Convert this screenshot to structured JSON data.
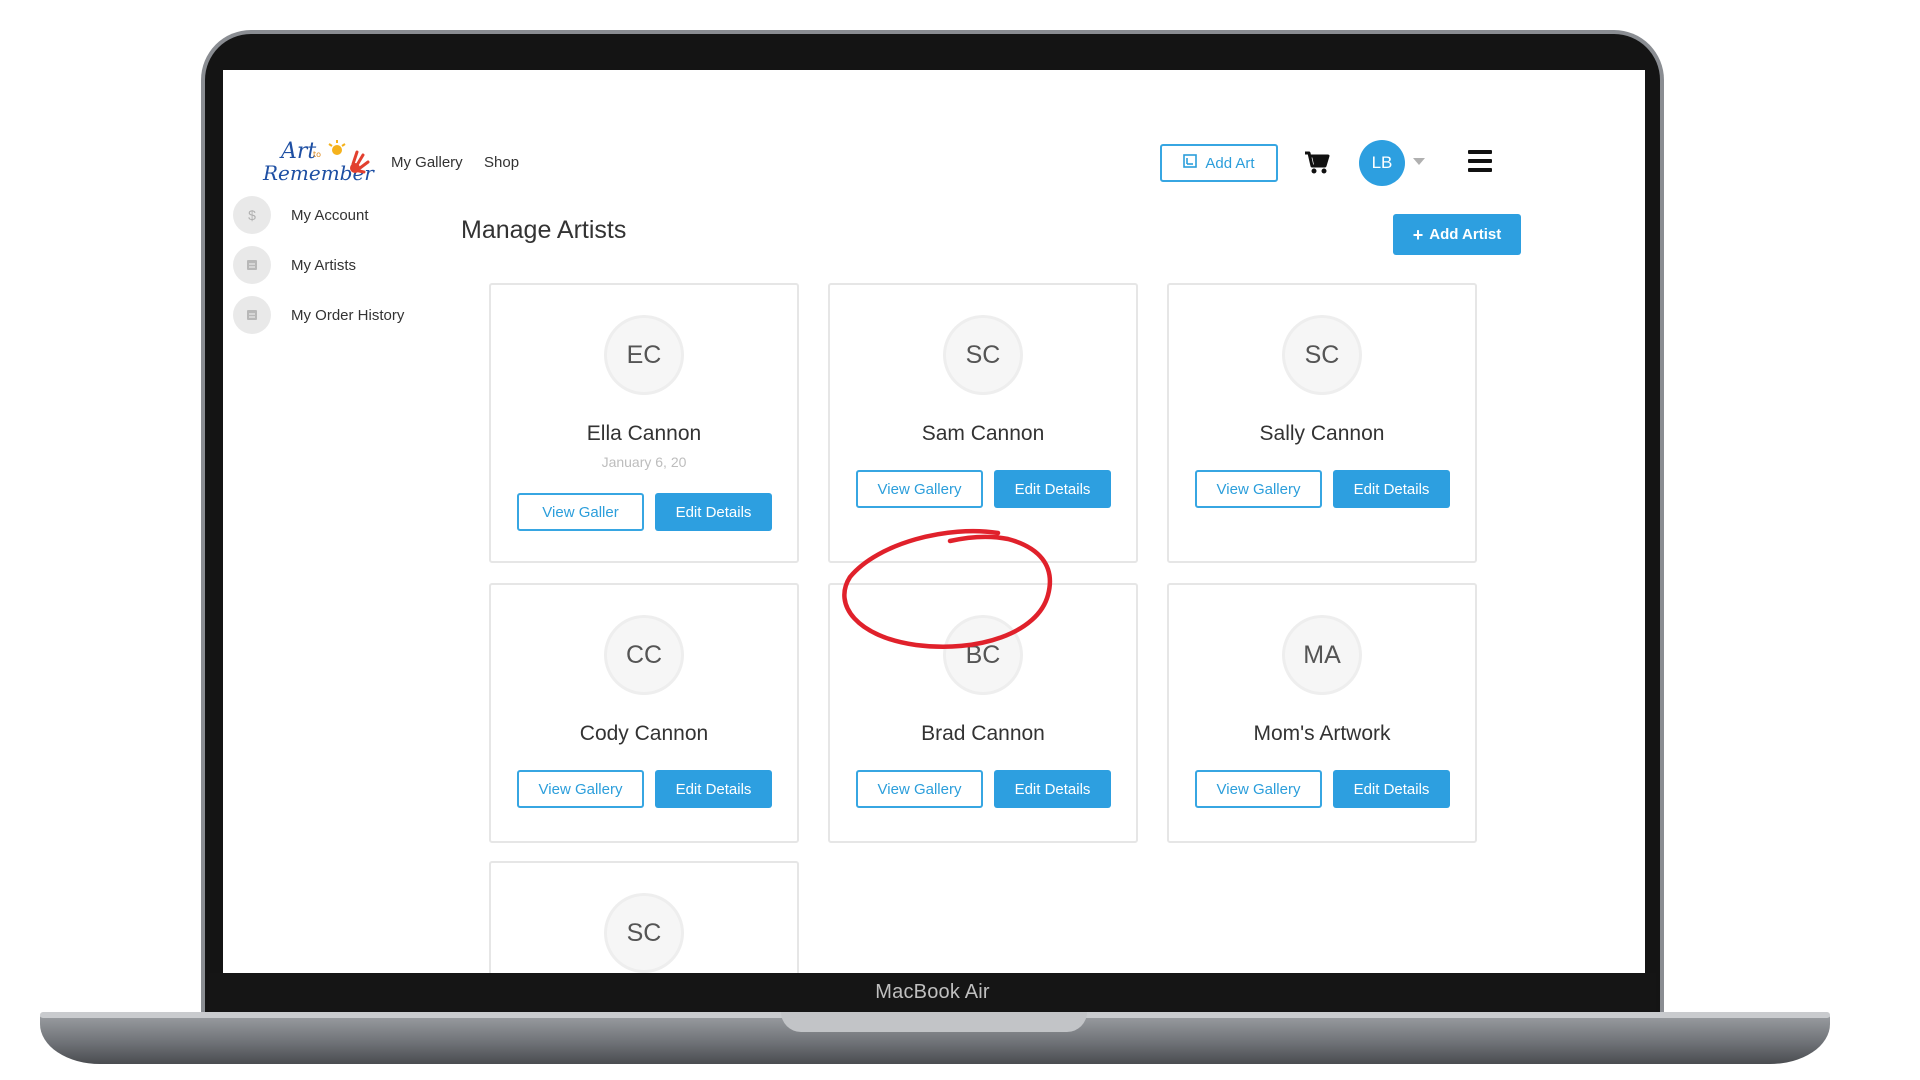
{
  "device": {
    "label": "MacBook Air"
  },
  "header": {
    "logo_alt": "Art to Remember",
    "nav": [
      "My Gallery",
      "Shop"
    ],
    "add_art_label": "Add Art",
    "user_initials": "LB"
  },
  "sidebar": {
    "items": [
      {
        "label": "My Account",
        "icon": "dollar-icon"
      },
      {
        "label": "My Artists",
        "icon": "list-icon"
      },
      {
        "label": "My Order History",
        "icon": "list-icon"
      }
    ]
  },
  "main": {
    "title": "Manage Artists",
    "add_artist_label": "Add Artist",
    "artists": [
      {
        "initials": "EC",
        "name": "Ella Cannon",
        "date": "January 6, 20"
      },
      {
        "initials": "SC",
        "name": "Sam Cannon"
      },
      {
        "initials": "SC",
        "name": "Sally Cannon"
      },
      {
        "initials": "CC",
        "name": "Cody Cannon"
      },
      {
        "initials": "BC",
        "name": "Brad Cannon"
      },
      {
        "initials": "MA",
        "name": "Mom's Artwork"
      },
      {
        "initials": "SC"
      }
    ],
    "view_gallery_label": "View Gallery",
    "view_gallery_label_partial": "View Galler",
    "edit_details_label": "Edit Details"
  },
  "colors": {
    "accent": "#2d9fe0",
    "annotation": "#e0212b"
  }
}
